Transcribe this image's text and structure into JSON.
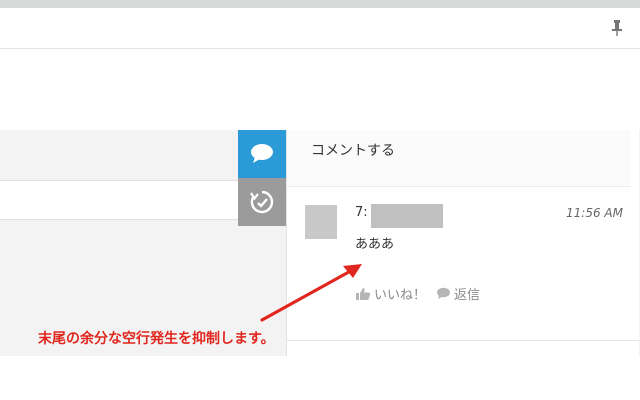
{
  "header": {
    "pin_icon": "pin-icon"
  },
  "sidebar": {
    "buttons": [
      {
        "icon": "comment-icon",
        "color": "#2b9bd8"
      },
      {
        "icon": "history-icon",
        "color": "#9b9b9b"
      }
    ]
  },
  "comment_panel": {
    "input_placeholder": "コメントする",
    "comment": {
      "number": "7:",
      "time": "11:56 AM",
      "body": "あああ",
      "like_label": "いいね！",
      "reply_label": "返信"
    }
  },
  "annotation": {
    "text": "末尾の余分な空行発生を抑制します。",
    "color": "#e0261e"
  }
}
